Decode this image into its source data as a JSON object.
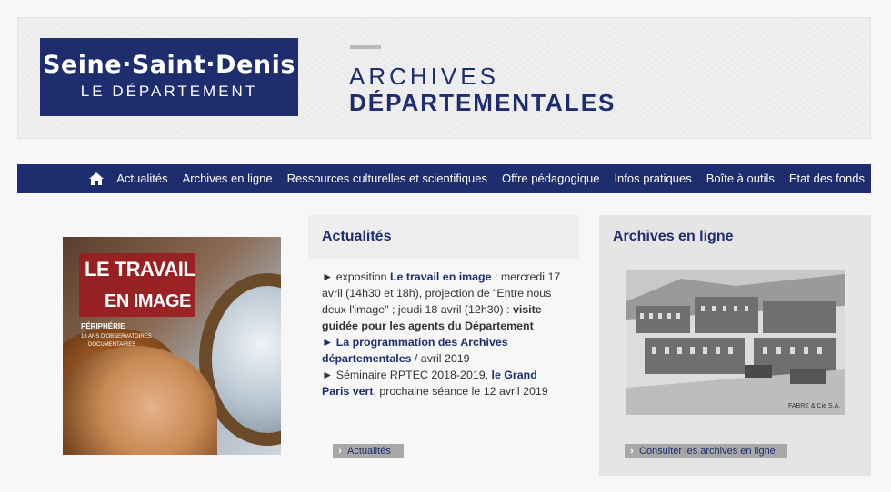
{
  "header": {
    "logo_main": "Seine·Saint·Denis",
    "logo_sub": "LE DÉPARTEMENT",
    "title_line1": "ARCHIVES",
    "title_line2": "DÉPARTEMENTALES"
  },
  "nav": {
    "home_icon": "home-icon",
    "items": [
      "Actualités",
      "Archives en ligne",
      "Ressources culturelles et scientifiques",
      "Offre pédagogique",
      "Infos pratiques",
      "Boîte à outils",
      "Etat des fonds"
    ]
  },
  "poster": {
    "title_line1": "LE TRAVAIL",
    "title_line2": "EN IMAGE",
    "subtitle_line1": "PÉRIPHÉRIE",
    "subtitle_line2": "18 ANS D'OBSERVATOIRES",
    "subtitle_line3": "DOCUMENTAIRES"
  },
  "actualites": {
    "heading": "Actualités",
    "items": [
      {
        "marker": "►",
        "prefix": " exposition ",
        "link": "Le travail en image",
        "text": " : mercredi 17 avril (14h30 et 18h), projection de \"Entre nous deux l'image\" ; jeudi 18 avril (12h30) : ",
        "bold": "visite guidée pour les agents du Département"
      },
      {
        "marker": "►",
        "link": "La programmation des Archives départementales",
        "text": " / avril 2019"
      },
      {
        "marker": "►",
        "prefix": " Séminaire RPTEC 2018-2019, ",
        "link": "le Grand Paris vert",
        "text": ", prochaine séance le 12 avril 2019"
      }
    ],
    "button_label": "Actualités"
  },
  "archives_en_ligne": {
    "heading": "Archives en ligne",
    "image_caption": "FABRE & Cie S.A.",
    "button_label": "Consulter les archives en ligne"
  },
  "colors": {
    "brand_blue": "#1d2d6e",
    "button_gray": "#a8a8a8"
  }
}
